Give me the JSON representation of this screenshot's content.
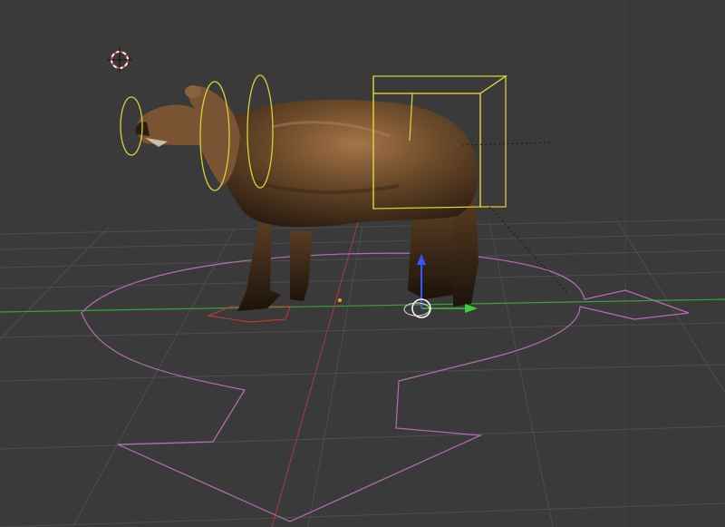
{
  "viewport": {
    "mode": "3D viewport",
    "object": "bear-rig",
    "colors": {
      "background": "#3a3a3a",
      "grid": "#4a4a4a",
      "x_axis": "#c83a3a",
      "y_axis": "#3aa03a",
      "rig_control": "#d8cf3a",
      "ik_path": "#c47fc4",
      "fur": "#6b4a2a"
    }
  },
  "icons": {
    "cursor": "3d-cursor-icon",
    "manipulator": "transform-manipulator-icon"
  }
}
